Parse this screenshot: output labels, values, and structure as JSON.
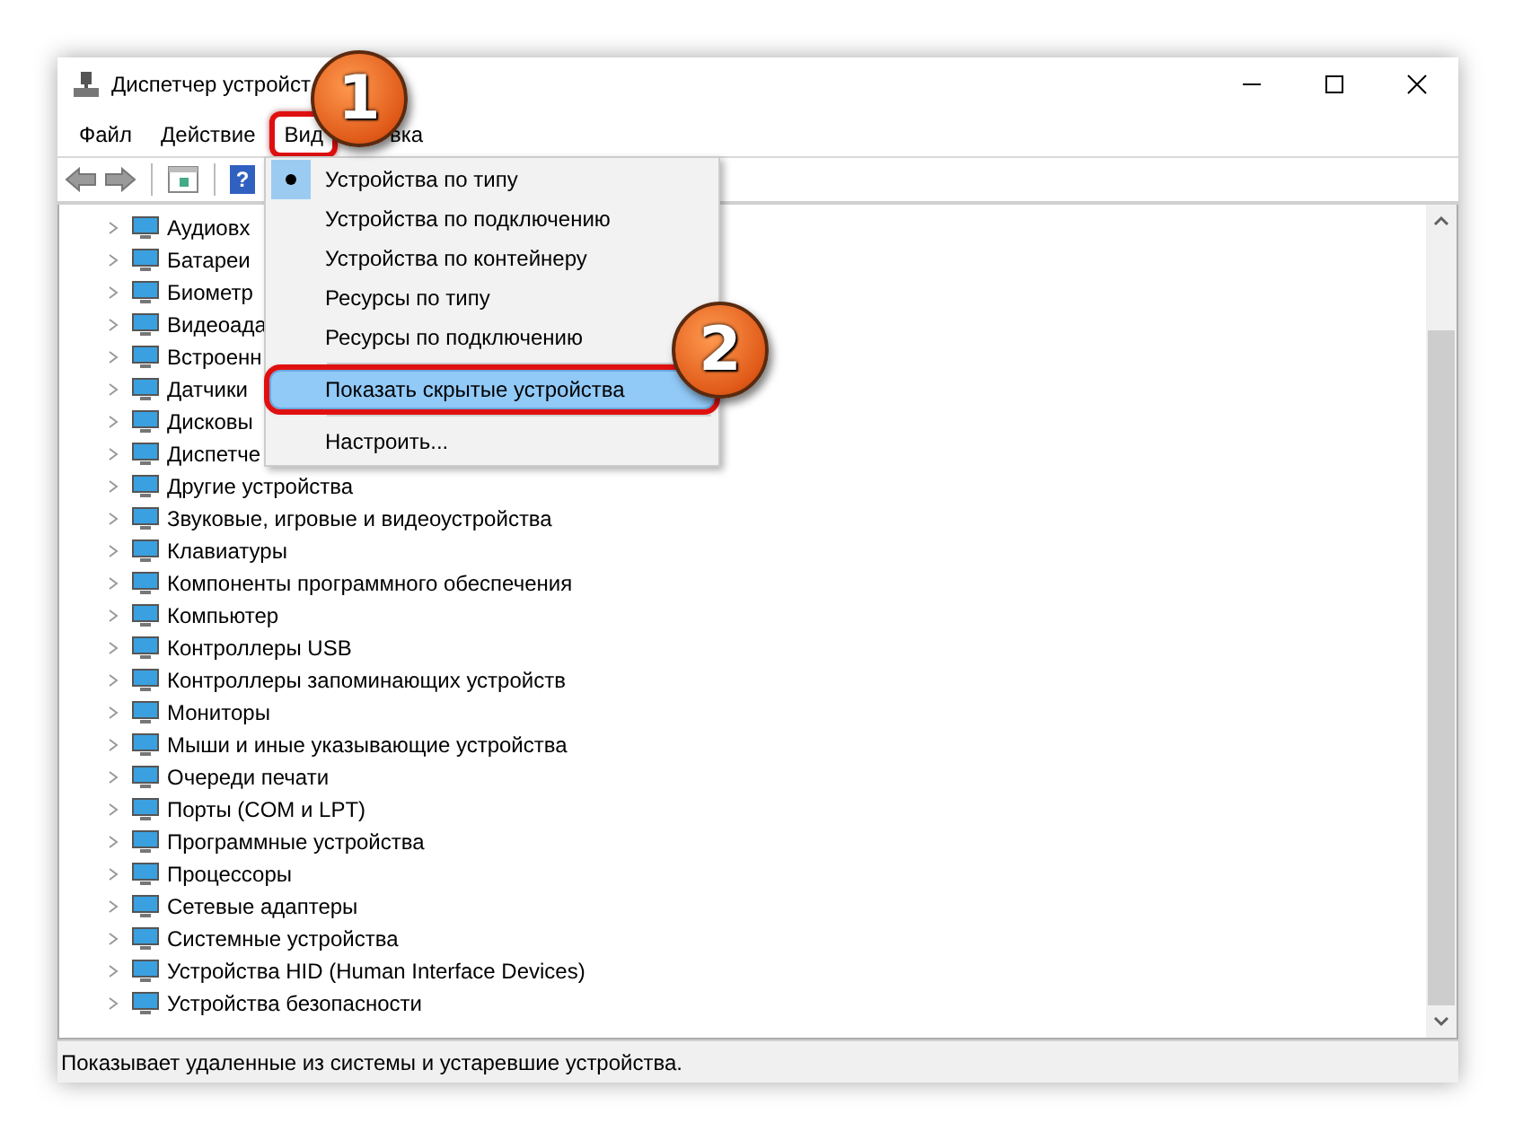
{
  "window": {
    "title": "Диспетчер устройст"
  },
  "menu_bar": [
    {
      "label": "Файл",
      "outlined": false
    },
    {
      "label": "Действие",
      "outlined": false
    },
    {
      "label": "Вид",
      "outlined": true
    },
    {
      "label": "вка",
      "outlined": false
    }
  ],
  "toolbar": {
    "help_glyph": "?"
  },
  "view_menu": [
    {
      "kind": "item",
      "label": "Устройства по типу",
      "selected": true,
      "highlighted": false,
      "outlined": false
    },
    {
      "kind": "item",
      "label": "Устройства по подключению",
      "selected": false,
      "highlighted": false,
      "outlined": false
    },
    {
      "kind": "item",
      "label": "Устройства по контейнеру",
      "selected": false,
      "highlighted": false,
      "outlined": false
    },
    {
      "kind": "item",
      "label": "Ресурсы по типу",
      "selected": false,
      "highlighted": false,
      "outlined": false
    },
    {
      "kind": "item",
      "label": "Ресурсы по подключению",
      "selected": false,
      "highlighted": false,
      "outlined": false
    },
    {
      "kind": "separator"
    },
    {
      "kind": "item",
      "label": "Показать скрытые устройства",
      "selected": false,
      "highlighted": true,
      "outlined": true
    },
    {
      "kind": "separator"
    },
    {
      "kind": "item",
      "label": "Настроить...",
      "selected": false,
      "highlighted": false,
      "outlined": false
    }
  ],
  "tree": [
    {
      "label": "Аудиовх",
      "expanded": false
    },
    {
      "label": "Батареи",
      "expanded": false
    },
    {
      "label": "Биометр",
      "expanded": false
    },
    {
      "label": "Видеоада",
      "expanded": false
    },
    {
      "label": "Встроенн",
      "expanded": false
    },
    {
      "label": "Датчики",
      "expanded": false
    },
    {
      "label": "Дисковы",
      "expanded": false
    },
    {
      "label": "Диспетче",
      "expanded": false
    },
    {
      "label": "Другие устройства",
      "expanded": false
    },
    {
      "label": "Звуковые, игровые и видеоустройства",
      "expanded": false
    },
    {
      "label": "Клавиатуры",
      "expanded": false
    },
    {
      "label": "Компоненты программного обеспечения",
      "expanded": false
    },
    {
      "label": "Компьютер",
      "expanded": false
    },
    {
      "label": "Контроллеры USB",
      "expanded": false
    },
    {
      "label": "Контроллеры запоминающих устройств",
      "expanded": false
    },
    {
      "label": "Мониторы",
      "expanded": false
    },
    {
      "label": "Мыши и иные указывающие устройства",
      "expanded": false
    },
    {
      "label": "Очереди печати",
      "expanded": false
    },
    {
      "label": "Порты (COM и LPT)",
      "expanded": false
    },
    {
      "label": "Программные устройства",
      "expanded": false
    },
    {
      "label": "Процессоры",
      "expanded": false
    },
    {
      "label": "Сетевые адаптеры",
      "expanded": false
    },
    {
      "label": "Системные устройства",
      "expanded": false
    },
    {
      "label": "Устройства HID (Human Interface Devices)",
      "expanded": false
    },
    {
      "label": "Устройства безопасности",
      "expanded": false
    }
  ],
  "status_bar": "Показывает удаленные из системы и устаревшие устройства.",
  "callouts": [
    {
      "number": "1"
    },
    {
      "number": "2"
    }
  ]
}
